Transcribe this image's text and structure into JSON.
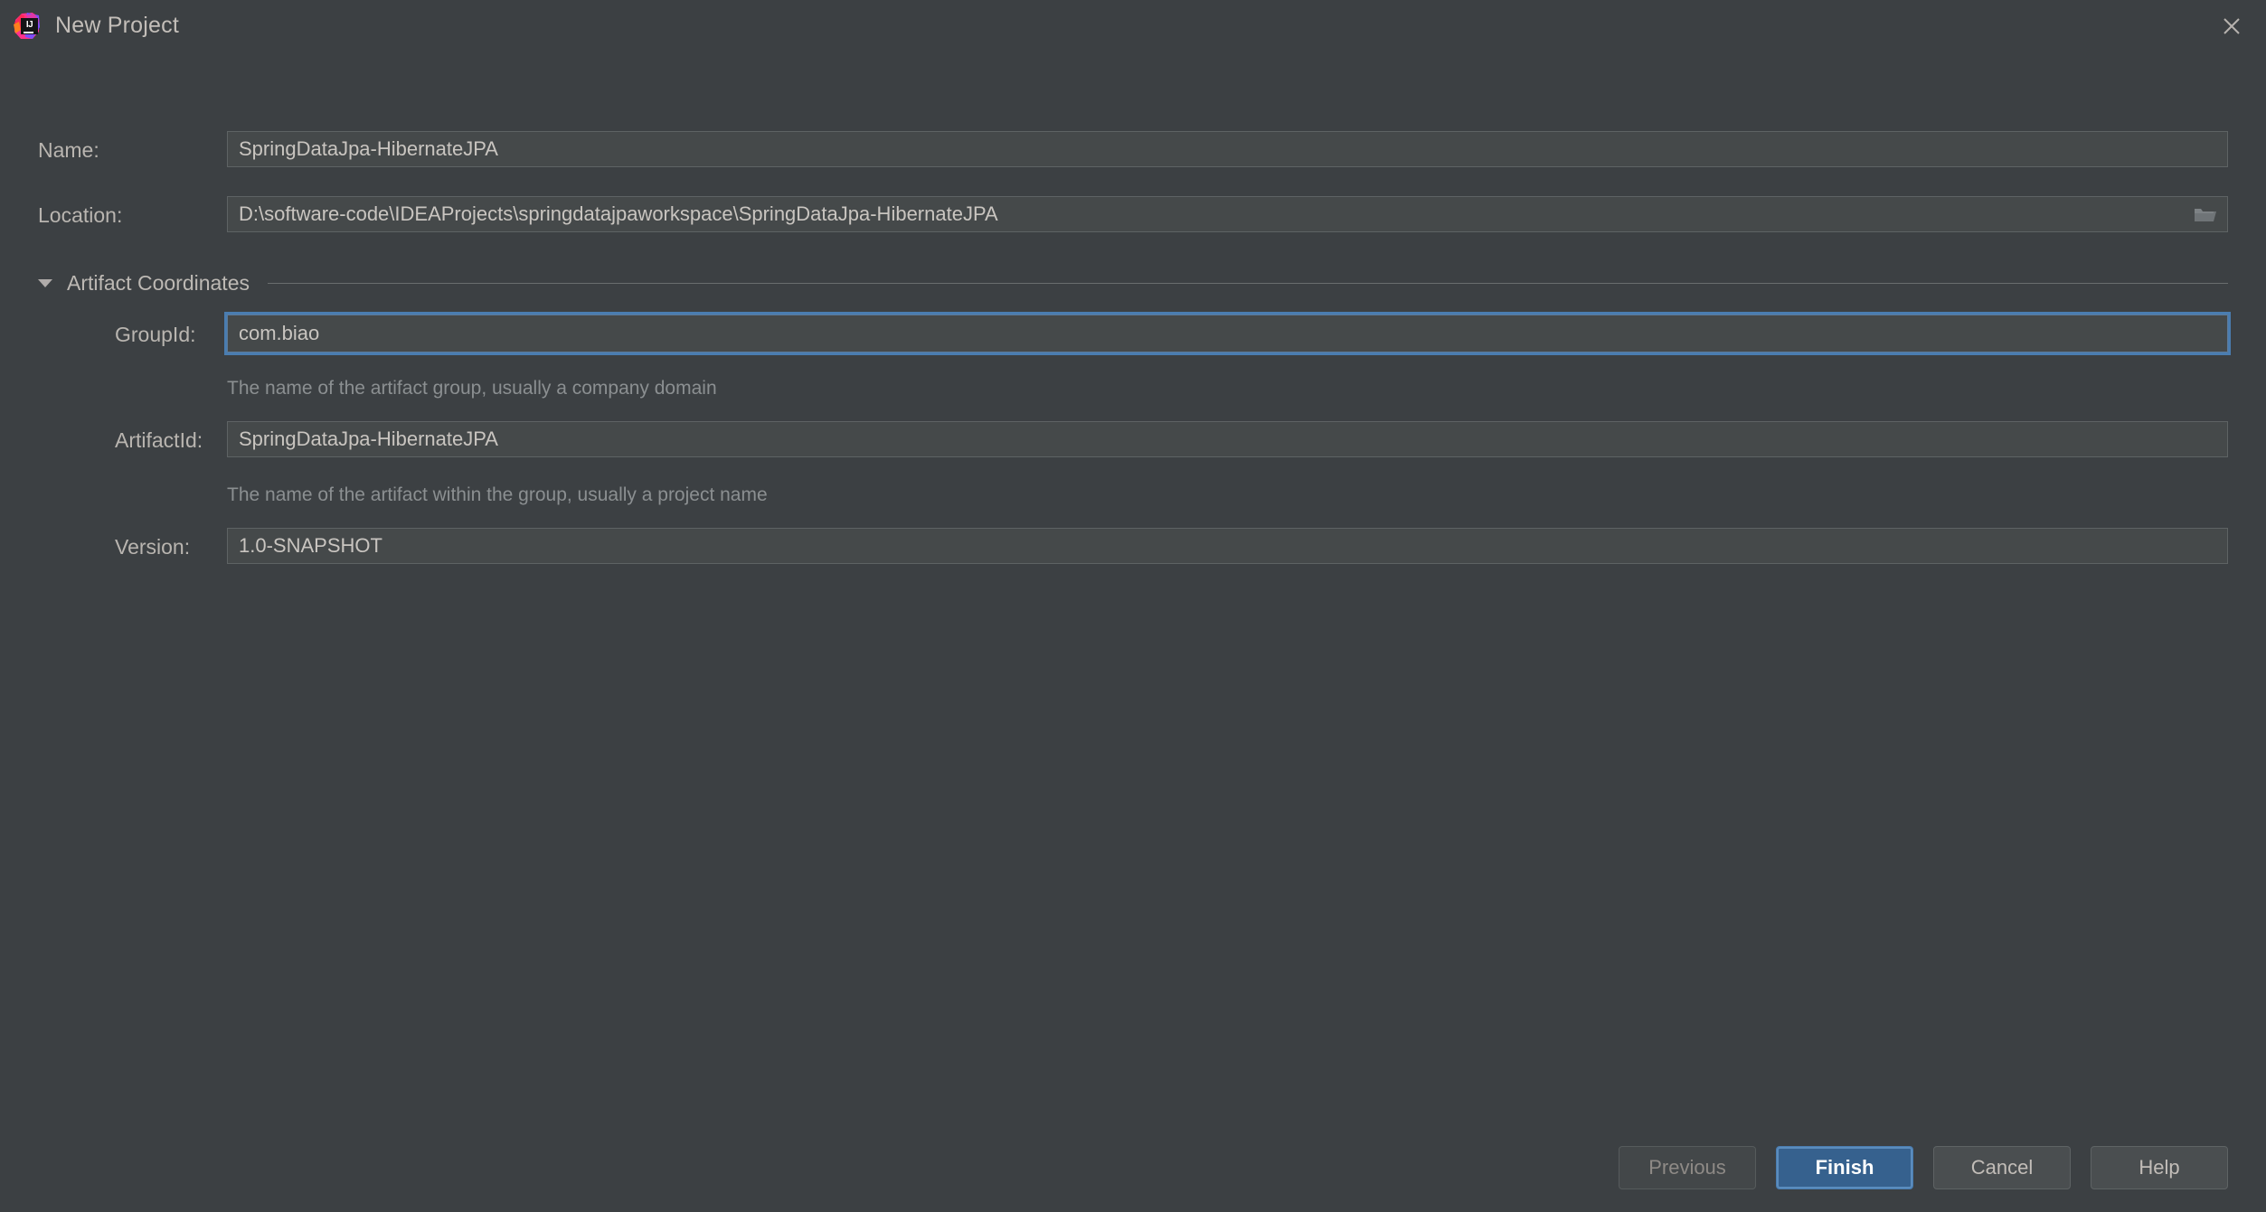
{
  "window": {
    "title": "New Project",
    "logo_alt": "IJ",
    "close_label": "×"
  },
  "form": {
    "name": {
      "label": "Name:",
      "value": "SpringDataJpa-HibernateJPA",
      "placeholder": ""
    },
    "location": {
      "label": "Location:",
      "value": "D:\\software-code\\IDEAProjects\\springdatajpaworkspace\\SpringDataJpa-HibernateJPA",
      "placeholder": "",
      "browse_icon": "folder-icon"
    },
    "section": {
      "title": "Artifact Coordinates",
      "expanded": true,
      "twisty_icon": "triangle-down-icon"
    },
    "group_id": {
      "label": "GroupId:",
      "value": "com.biao",
      "placeholder": "",
      "helper": "The name of the artifact group, usually a company domain",
      "focused": true
    },
    "artifact_id": {
      "label": "ArtifactId:",
      "value": "SpringDataJpa-HibernateJPA",
      "placeholder": "",
      "helper": "The name of the artifact within the group, usually a project name"
    },
    "version": {
      "label": "Version:",
      "value": "1.0-SNAPSHOT",
      "placeholder": ""
    }
  },
  "footer": {
    "previous": "Previous",
    "finish": "Finish",
    "cancel": "Cancel",
    "help": "Help"
  },
  "colors": {
    "background": "#3c4043",
    "field_background": "#45494a",
    "field_border": "#5e6364",
    "focus_ring": "#4a7db1",
    "primary_button": "#36618e",
    "text": "#bdb9b4",
    "helper_text": "#8b8f91"
  }
}
